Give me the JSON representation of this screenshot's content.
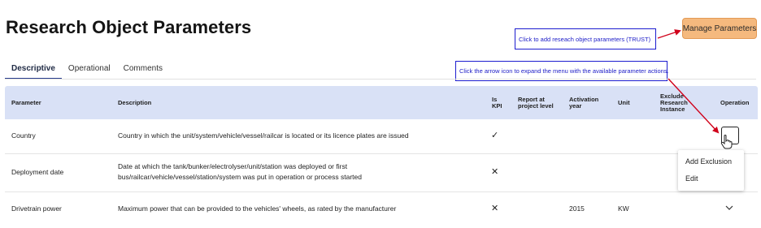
{
  "header": {
    "title": "Research Object Parameters",
    "manage_button": "Manage Parameters"
  },
  "callouts": {
    "add_params": "Click to add reseach object parameters (TRUST)",
    "arrow_icon": "Click the arrow icon to expand the menu with the available parameter actions."
  },
  "tabs": [
    {
      "label": "Descriptive",
      "active": true
    },
    {
      "label": "Operational",
      "active": false
    },
    {
      "label": "Comments",
      "active": false
    }
  ],
  "table": {
    "headers": {
      "parameter": "Parameter",
      "description": "Description",
      "is_kpi_1": "Is",
      "is_kpi_2": "KPI",
      "report_1": "Report at",
      "report_2": "project level",
      "activation_1": "Activation",
      "activation_2": "year",
      "unit": "Unit",
      "exclude_1": "Exclude",
      "exclude_2": "Research",
      "exclude_3": "Instance",
      "operation": "Operation"
    },
    "rows": [
      {
        "parameter": "Country",
        "description_1": "Country in which the unit/system/vehicle/vessel/railcar is located or its licence plates are issued",
        "is_kpi": "✓"
      },
      {
        "parameter": "Deployment date",
        "description_1": "Date at which the tank/bunker/electrolyser/unit/station was deployed or first",
        "description_2": "bus/railcar/vehicle/vessel/station/system was put in operation or process started",
        "is_kpi": "✕"
      },
      {
        "parameter": "Drivetrain power",
        "description_1": "Maximum power that can be provided to the vehicles' wheels, as rated by the manufacturer",
        "is_kpi": "✕",
        "activation_year": "2015",
        "unit": "KW"
      }
    ]
  },
  "operation_menu": {
    "items": [
      "Add Exclusion",
      "Edit"
    ]
  },
  "colors": {
    "header_bg": "#d9e1f6",
    "manage_button_bg": "#f5b97e",
    "callout_border": "#1c1ccf",
    "arrow": "#d0021b",
    "tab_underline": "#283c8c"
  }
}
